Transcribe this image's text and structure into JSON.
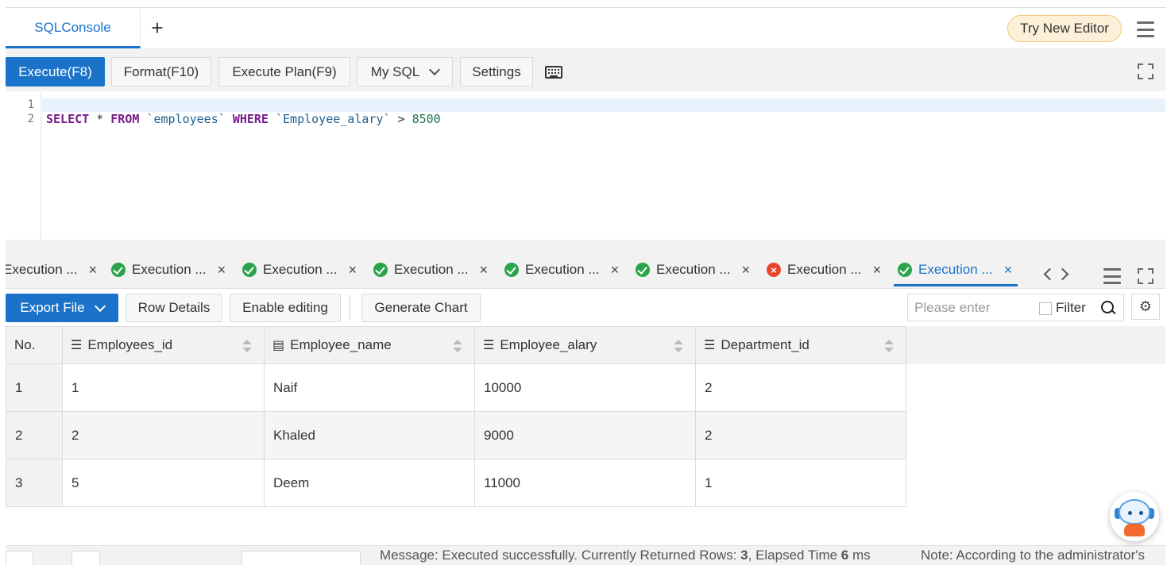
{
  "top_tabs": {
    "console_label": "SQLConsole",
    "add_label": "+"
  },
  "try_new_editor": "Try New Editor",
  "toolbar": {
    "execute": "Execute(F8)",
    "format": "Format(F10)",
    "execute_plan": "Execute Plan(F9)",
    "dialect": "My SQL",
    "settings": "Settings"
  },
  "editor": {
    "line_numbers": [
      "1",
      "2"
    ],
    "line2": {
      "kw_select": "SELECT",
      "star": " * ",
      "kw_from": "FROM",
      "table": " `employees` ",
      "kw_where": "WHERE",
      "column": " `Employee_alary` ",
      "op": "> ",
      "value": "8500"
    }
  },
  "result_tabs": [
    {
      "label": "Execution ...",
      "status": "none"
    },
    {
      "label": "Execution ...",
      "status": "success"
    },
    {
      "label": "Execution ...",
      "status": "success"
    },
    {
      "label": "Execution ...",
      "status": "success"
    },
    {
      "label": "Execution ...",
      "status": "success"
    },
    {
      "label": "Execution ...",
      "status": "success"
    },
    {
      "label": "Execution ...",
      "status": "error"
    },
    {
      "label": "Execution ...",
      "status": "success",
      "active": true
    }
  ],
  "result_toolbar": {
    "export": "Export File",
    "row_details": "Row Details",
    "enable_editing": "Enable editing",
    "generate_chart": "Generate Chart",
    "search_placeholder": "Please enter",
    "filter_label": "Filter"
  },
  "table": {
    "columns": [
      "No.",
      "Employees_id",
      "Employee_name",
      "Employee_alary",
      "Department_id"
    ],
    "column_icons": [
      "",
      "list-icon",
      "text-icon",
      "list-icon",
      "list-icon"
    ],
    "rows": [
      [
        "1",
        "1",
        "Naif",
        "10000",
        "2"
      ],
      [
        "2",
        "2",
        "Khaled",
        "9000",
        "2"
      ],
      [
        "3",
        "5",
        "Deem",
        "11000",
        "1"
      ]
    ]
  },
  "status_bar": {
    "message_prefix": "Message: Executed successfully. Currently Returned Rows: ",
    "rows": "3",
    "elapsed_prefix": ", Elapsed Time ",
    "elapsed": "6",
    "elapsed_unit": " ms",
    "note": "Note: According to the administrator's"
  },
  "colors": {
    "accent": "#1a73c8",
    "success": "#2aa34a",
    "error": "#e8452f",
    "try_editor_bg": "#fdf0d8"
  }
}
